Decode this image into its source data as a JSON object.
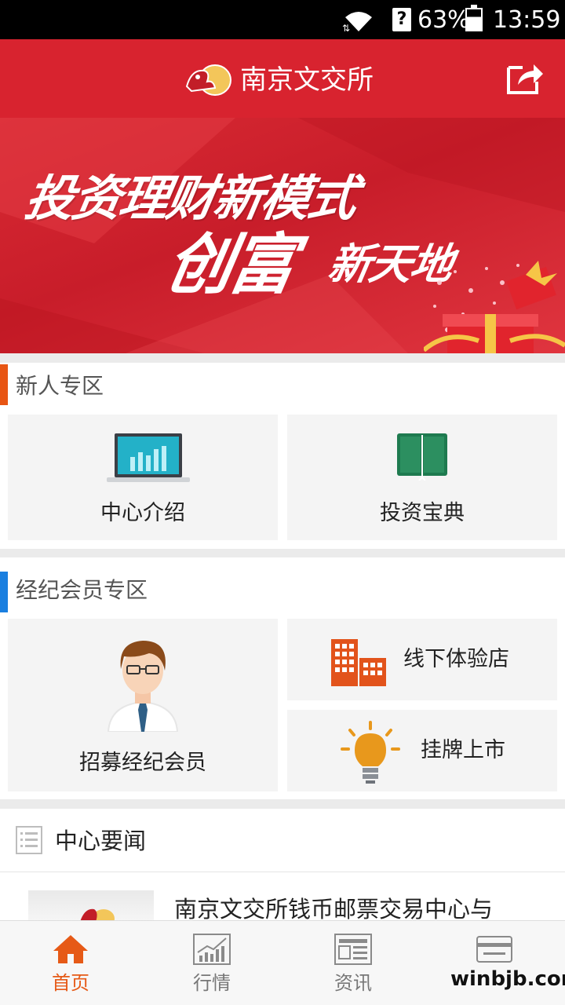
{
  "status_bar": {
    "battery": "63%",
    "time": "13:59",
    "sim": "?"
  },
  "header": {
    "title": "南京文交所"
  },
  "banner": {
    "line1": "投资理财新模式",
    "line2a": "创富",
    "line2b": "新天地"
  },
  "section_newcomer": {
    "title": "新人专区",
    "accent": "#e85513",
    "tiles": [
      {
        "label": "中心介绍",
        "icon": "laptop-chart-icon"
      },
      {
        "label": "投资宝典",
        "icon": "book-icon"
      }
    ]
  },
  "section_broker": {
    "title": "经纪会员专区",
    "accent": "#1a7fe0",
    "tiles": [
      {
        "label": "招募经纪会员",
        "icon": "person-icon"
      },
      {
        "label": "线下体验店",
        "icon": "buildings-icon"
      },
      {
        "label": "挂牌上市",
        "icon": "lightbulb-icon"
      }
    ]
  },
  "news": {
    "title": "中心要闻",
    "items": [
      {
        "text": "南京文交所钱币邮票交易中心与"
      }
    ]
  },
  "bottom_nav": {
    "active_color": "#e65a17",
    "items": [
      {
        "label": "首页",
        "icon": "home-icon",
        "active": true
      },
      {
        "label": "行情",
        "icon": "market-chart-icon",
        "active": false
      },
      {
        "label": "资讯",
        "icon": "newspaper-icon",
        "active": false
      },
      {
        "label": "",
        "icon": "card-icon",
        "active": false
      }
    ]
  },
  "watermark": "winbjb.com"
}
